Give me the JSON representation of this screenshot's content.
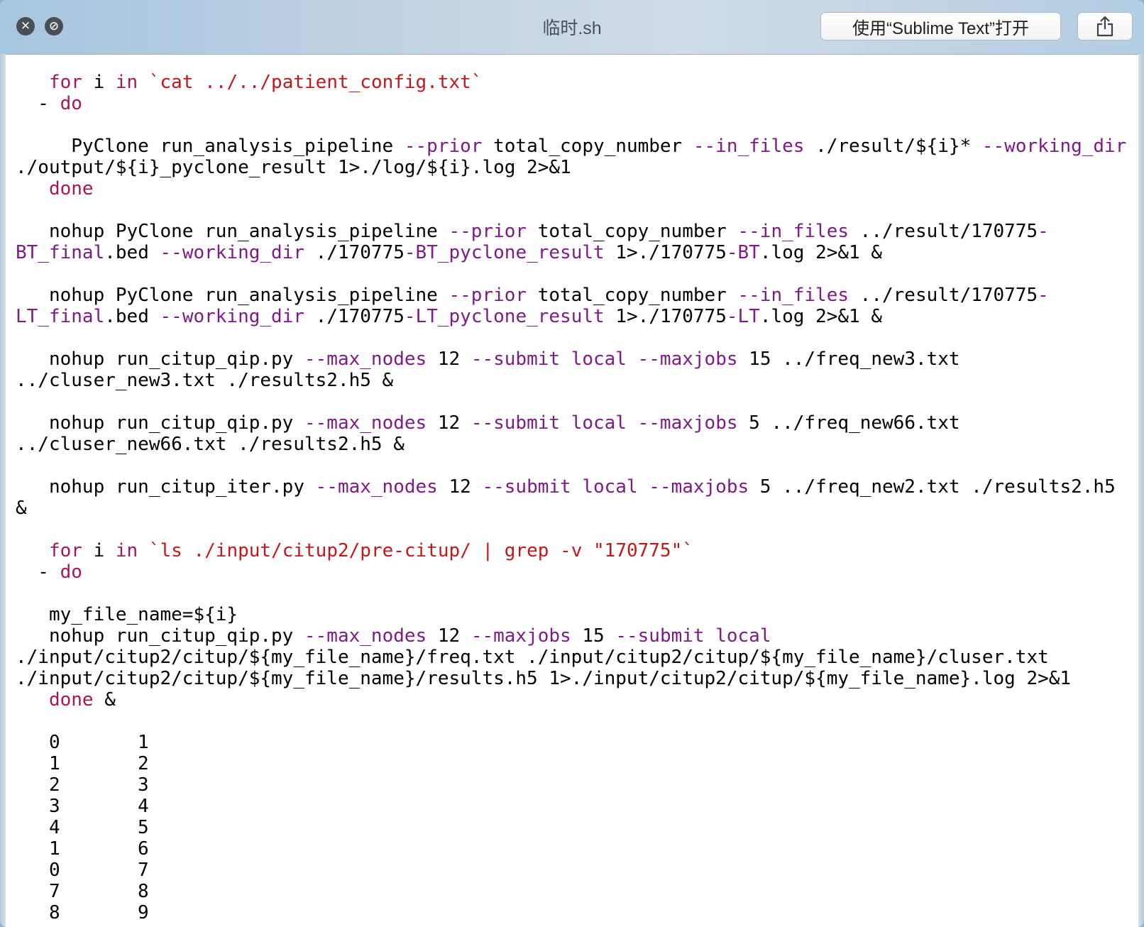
{
  "window": {
    "title": "临时.sh",
    "open_with_button": "使用“Sublime Text”打开"
  },
  "code_lines": [
    [
      [
        "   ",
        ""
      ],
      [
        "for",
        "kw"
      ],
      [
        " i ",
        ""
      ],
      [
        "in",
        "kw"
      ],
      [
        " ",
        ""
      ],
      [
        "`cat ../../patient_config.txt`",
        "str"
      ]
    ],
    [
      [
        "  - ",
        ""
      ],
      [
        "do",
        "kw"
      ]
    ],
    [],
    [
      [
        "     PyClone run_analysis_pipeline ",
        ""
      ],
      [
        "--prior",
        "fl"
      ],
      [
        " total_copy_number ",
        ""
      ],
      [
        "--in_files",
        "fl"
      ],
      [
        " ./result/${i}* ",
        ""
      ],
      [
        "--working_dir",
        "fl"
      ]
    ],
    [
      [
        "./output/${i}_pyclone_result 1>./log/${i}.log 2>&1",
        ""
      ]
    ],
    [
      [
        "   ",
        ""
      ],
      [
        "done",
        "kw"
      ]
    ],
    [],
    [
      [
        "   nohup PyClone run_analysis_pipeline ",
        ""
      ],
      [
        "--prior",
        "fl"
      ],
      [
        " total_copy_number ",
        ""
      ],
      [
        "--in_files",
        "fl"
      ],
      [
        " ../result/170775",
        ""
      ],
      [
        "-",
        "fl"
      ]
    ],
    [
      [
        "BT_final",
        "fl"
      ],
      [
        ".bed ",
        ""
      ],
      [
        "--working_dir",
        "fl"
      ],
      [
        " ./170775",
        ""
      ],
      [
        "-BT_pyclone_result",
        "fl"
      ],
      [
        " 1>./170775",
        ""
      ],
      [
        "-BT",
        "fl"
      ],
      [
        ".log 2>&1 &",
        ""
      ]
    ],
    [],
    [
      [
        "   nohup PyClone run_analysis_pipeline ",
        ""
      ],
      [
        "--prior",
        "fl"
      ],
      [
        " total_copy_number ",
        ""
      ],
      [
        "--in_files",
        "fl"
      ],
      [
        " ../result/170775",
        ""
      ],
      [
        "-",
        "fl"
      ]
    ],
    [
      [
        "LT_final",
        "fl"
      ],
      [
        ".bed ",
        ""
      ],
      [
        "--working_dir",
        "fl"
      ],
      [
        " ./170775",
        ""
      ],
      [
        "-LT_pyclone_result",
        "fl"
      ],
      [
        " 1>./170775",
        ""
      ],
      [
        "-LT",
        "fl"
      ],
      [
        ".log 2>&1 &",
        ""
      ]
    ],
    [],
    [
      [
        "   nohup run_citup_qip.py ",
        ""
      ],
      [
        "--max_nodes",
        "fl"
      ],
      [
        " 12 ",
        ""
      ],
      [
        "--submit local",
        "fl"
      ],
      [
        " ",
        ""
      ],
      [
        "--maxjobs",
        "fl"
      ],
      [
        " 15 ../freq_new3.txt",
        ""
      ]
    ],
    [
      [
        "../cluser_new3.txt ./results2.h5 &",
        ""
      ]
    ],
    [],
    [
      [
        "   nohup run_citup_qip.py ",
        ""
      ],
      [
        "--max_nodes",
        "fl"
      ],
      [
        " 12 ",
        ""
      ],
      [
        "--submit local",
        "fl"
      ],
      [
        " ",
        ""
      ],
      [
        "--maxjobs",
        "fl"
      ],
      [
        " 5 ../freq_new66.txt",
        ""
      ]
    ],
    [
      [
        "../cluser_new66.txt ./results2.h5 &",
        ""
      ]
    ],
    [],
    [
      [
        "   nohup run_citup_iter.py ",
        ""
      ],
      [
        "--max_nodes",
        "fl"
      ],
      [
        " 12 ",
        ""
      ],
      [
        "--submit local",
        "fl"
      ],
      [
        " ",
        ""
      ],
      [
        "--maxjobs",
        "fl"
      ],
      [
        " 5 ../freq_new2.txt ./results2.h5",
        ""
      ]
    ],
    [
      [
        "&",
        ""
      ]
    ],
    [],
    [
      [
        "   ",
        ""
      ],
      [
        "for",
        "kw"
      ],
      [
        " i ",
        ""
      ],
      [
        "in",
        "kw"
      ],
      [
        " ",
        ""
      ],
      [
        "`ls ./input/citup2/pre-citup/ | grep -v \"170775\"`",
        "str"
      ]
    ],
    [
      [
        "  - ",
        ""
      ],
      [
        "do",
        "kw"
      ]
    ],
    [],
    [
      [
        "   my_file_name=${i}",
        ""
      ]
    ],
    [
      [
        "   nohup run_citup_qip.py ",
        ""
      ],
      [
        "--max_nodes",
        "fl"
      ],
      [
        " 12 ",
        ""
      ],
      [
        "--maxjobs",
        "fl"
      ],
      [
        " 15 ",
        ""
      ],
      [
        "--submit local",
        "fl"
      ]
    ],
    [
      [
        "./input/citup2/citup/${my_file_name}/freq.txt ./input/citup2/citup/${my_file_name}/cluser.txt",
        ""
      ]
    ],
    [
      [
        "./input/citup2/citup/${my_file_name}/results.h5 1>./input/citup2/citup/${my_file_name}.log 2>&1",
        ""
      ]
    ],
    [
      [
        "   ",
        ""
      ],
      [
        "done",
        "kw"
      ],
      [
        " &",
        ""
      ]
    ],
    []
  ],
  "two_column_rows": [
    [
      "0",
      "1"
    ],
    [
      "1",
      "2"
    ],
    [
      "2",
      "3"
    ],
    [
      "3",
      "4"
    ],
    [
      "4",
      "5"
    ],
    [
      "1",
      "6"
    ],
    [
      "0",
      "7"
    ],
    [
      "7",
      "8"
    ],
    [
      "8",
      "9"
    ]
  ]
}
